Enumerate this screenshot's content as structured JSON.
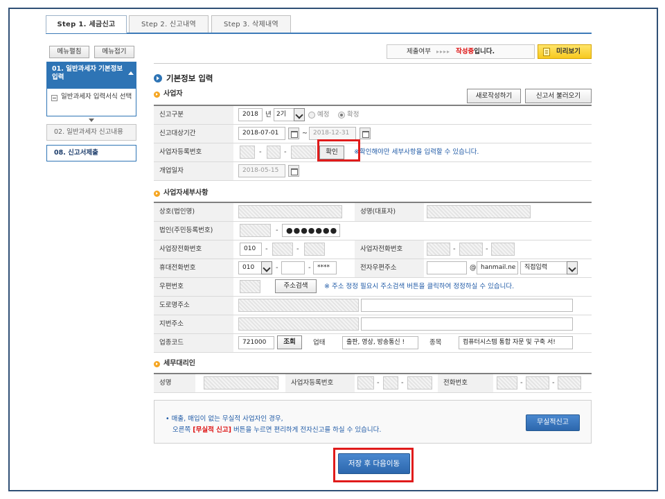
{
  "tabs": [
    {
      "label": "Step 1. 세금신고"
    },
    {
      "label": "Step 2. 신고내역"
    },
    {
      "label": "Step 3. 삭제내역"
    }
  ],
  "left_menu": {
    "expand_all": "메뉴펼침",
    "collapse_all": "메뉴접기",
    "active_item": "01. 일반과세자 기본정보 입력",
    "active_sub": "일반과세자 입력서식 선택",
    "item_02": "02. 일반과세자 신고내용",
    "item_08": "08. 신고서제출"
  },
  "status": {
    "label": "제출여부",
    "arrows": "▸▸▸▸",
    "value": "작성중",
    "suffix": "입니다.",
    "preview_button": "미리보기"
  },
  "basic_info": {
    "title": "기본정보 입력",
    "business_section": "사업자",
    "new_write_button": "새로작성하기",
    "load_button": "신고서 불러오기",
    "report_type_label": "신고구분",
    "year": "2018",
    "year_unit": "년",
    "period": "2기",
    "radio_scheduled": "예정",
    "radio_final": "확정",
    "target_period_label": "신고대상기간",
    "date_from": "2018-07-01",
    "date_sep": "~",
    "date_to": "2018-12-31",
    "brn_label": "사업자등록번호",
    "confirm_button": "확인",
    "brn_note": "※확인해야만 세부사항을 입력할 수 있습니다.",
    "open_date_label": "개업일자",
    "open_date": "2018-05-15"
  },
  "details": {
    "section": "사업자세부사항",
    "company_label": "상호(법인명)",
    "rep_label": "성명(대표자)",
    "corp_id_label": "법인(주민등록번호)",
    "corp_id_masked": "●●●●●●●",
    "office_phone_label": "사업장전화번호",
    "office_phone_prefix": "010",
    "biz_phone_label": "사업자전화번호",
    "mobile_label": "휴대전화번호",
    "mobile_prefix": "010",
    "mobile_last": "****",
    "email_label": "전자우편주소",
    "email_at": "@",
    "email_domain": "hanmail.ne",
    "email_select": "직접입력",
    "zip_label": "우편번호",
    "addr_search_button": "주소검색",
    "zip_note": "※ 주소 정정 필요시 주소검색 버튼을 클릭하여 정정하실 수 있습니다.",
    "road_addr_label": "도로명주소",
    "lot_addr_label": "지번주소",
    "industry_label": "업종코드",
    "industry_code": "721000",
    "lookup_button": "조회",
    "business_type_label": "업태",
    "business_type": "출판, 영상, 방송통신 !",
    "item_label": "종목",
    "item_value": "컴퓨터시스템 통합 자문 및 구축 서!"
  },
  "agent": {
    "section": "세무대리인",
    "name_label": "성명",
    "brn_label": "사업자등록번호",
    "phone_label": "전화번호"
  },
  "notice": {
    "line1": "• 매출, 매입이 없는 무실적 사업자인 경우,",
    "line2_pre": "오른쪽 ",
    "line2_red": "[무실적 신고]",
    "line2_post": " 버튼을 누르면 편리하게 전자신고를 하실 수 있습니다.",
    "button": "무실적신고"
  },
  "save_next_button": "저장 후 다음이동",
  "colors": {
    "accent": "#2e74b5",
    "highlight": "#e01b1b",
    "status": "#d11111"
  }
}
